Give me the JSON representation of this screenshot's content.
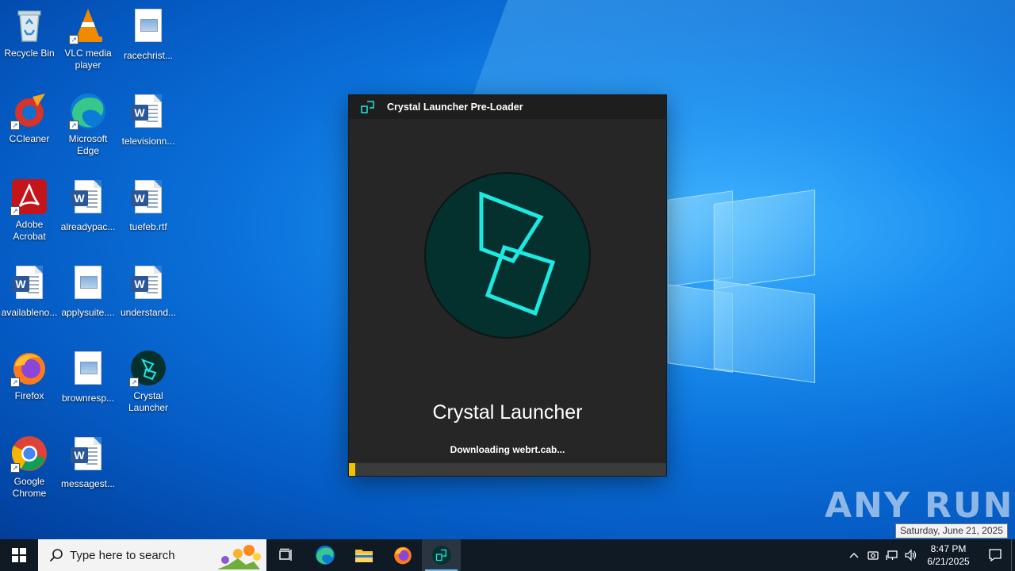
{
  "desktop": {
    "icons": [
      {
        "label": "Recycle Bin",
        "type": "recycle"
      },
      {
        "label": "VLC media player",
        "type": "vlc"
      },
      {
        "label": "racechrist...",
        "type": "image"
      },
      {
        "label": "CCleaner",
        "type": "ccleaner"
      },
      {
        "label": "Microsoft Edge",
        "type": "edge"
      },
      {
        "label": "televisionn...",
        "type": "word"
      },
      {
        "label": "Adobe Acrobat",
        "type": "acrobat"
      },
      {
        "label": "alreadypac...",
        "type": "word"
      },
      {
        "label": "tuefeb.rtf",
        "type": "word"
      },
      {
        "label": "availableno...",
        "type": "word"
      },
      {
        "label": "applysuite....",
        "type": "image"
      },
      {
        "label": "understand...",
        "type": "word"
      },
      {
        "label": "Firefox",
        "type": "firefox"
      },
      {
        "label": "brownresp...",
        "type": "image"
      },
      {
        "label": "Crystal Launcher",
        "type": "crystal"
      },
      {
        "label": "Google Chrome",
        "type": "chrome"
      },
      {
        "label": "messagest...",
        "type": "word"
      }
    ]
  },
  "dialog": {
    "title": "Crystal Launcher Pre-Loader",
    "app_name": "Crystal Launcher",
    "status": "Downloading webrt.cab...",
    "progress": 0.02,
    "colors": {
      "accent": "#1de9e0",
      "progress": "#f2c300",
      "logo_bg": "#04302e"
    }
  },
  "watermark": {
    "text": "ANY RUN"
  },
  "tooltip": {
    "text": "Saturday, June 21, 2025"
  },
  "taskbar": {
    "search_placeholder": "Type here to search",
    "pinned": [
      "task-view",
      "edge",
      "file-explorer",
      "firefox",
      "crystal-launcher"
    ],
    "clock": {
      "time": "8:47 PM",
      "date": "6/21/2025"
    }
  }
}
